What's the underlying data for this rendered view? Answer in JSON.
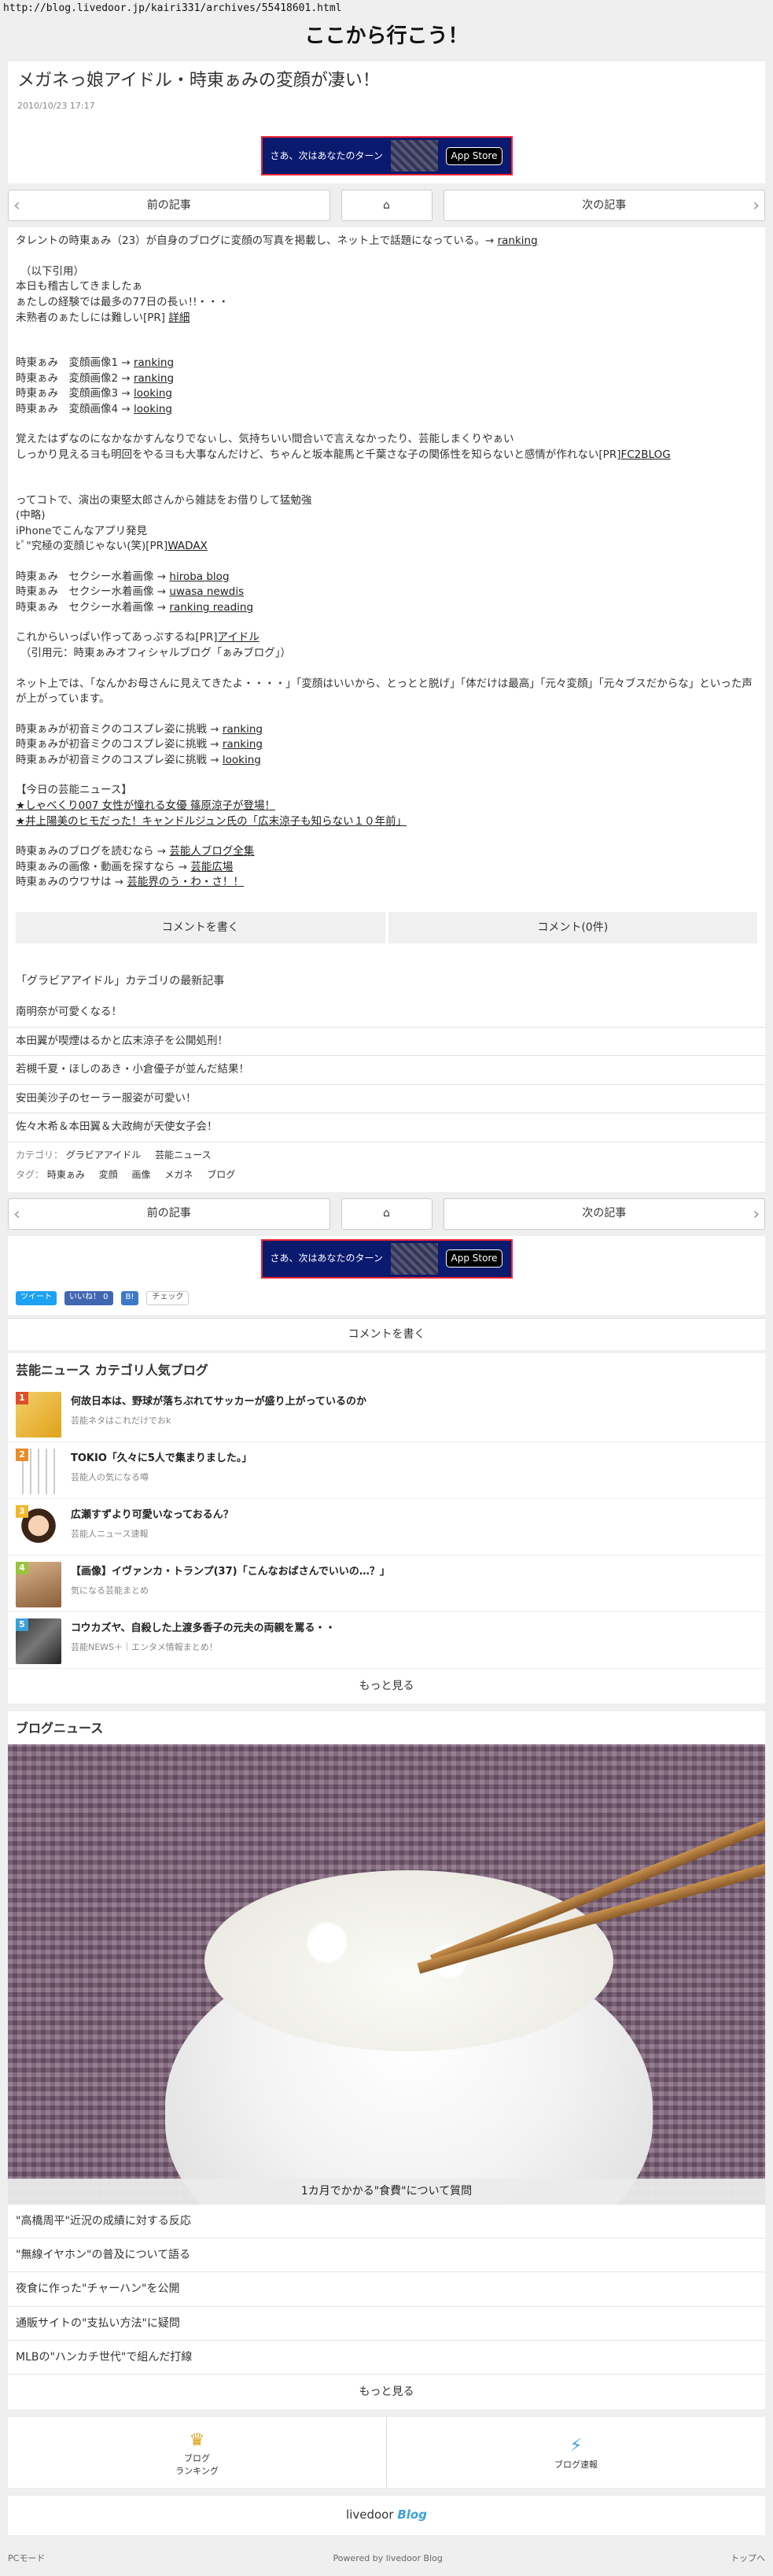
{
  "url": "http://blog.livedoor.jp/kairi331/archives/55418601.html",
  "site_title": "ここから行こう！",
  "article": {
    "title": "メガネっ娘アイドル・時東ぁみの変顔が凄い！",
    "date": "2010/10/23 17:17"
  },
  "ad": {
    "text": "さあ、次はあなたのターン",
    "store": "App Store"
  },
  "pager": {
    "prev": "前の記事",
    "next": "次の記事"
  },
  "body": {
    "lead": "タレントの時東ぁみ（23）が自身のブログに変顔の写真を掲載し、ネット上で話題になっている。→ ",
    "lead_link": "ranking",
    "quote_open": "（以下引用）",
    "q1": "本日も稽古してきましたぁ",
    "q2": "ぁたしの経験では最多の77日の長ぃ!!・・・",
    "q3a": "未熟者のぁたしには難しい[PR] ",
    "q3_link": "詳細",
    "img1": "時東ぁみ　変顔画像1 → ",
    "img1_link": "ranking",
    "img2": "時東ぁみ　変顔画像2 → ",
    "img2_link": "ranking",
    "img3": "時東ぁみ　変顔画像3 → ",
    "img3_link": "looking",
    "img4": "時東ぁみ　変顔画像4 → ",
    "img4_link": "looking",
    "p2a": "覚えたはずなのになかなかすんなりでなぃし、気持ちいい間合いで言えなかったり、芸能しまくりやぁい",
    "p2b": "しっかり見えるヨも明回をやるヨも大事なんだけど、ちゃんと坂本龍馬と千葉さな子の関係性を知らないと感情が作れない[PR]",
    "p2b_link": "FC2BLOG",
    "p3a": "ってコトで、演出の東堅太郎さんから雑誌をお借りして猛勉強",
    "p3b": "(中略)",
    "p3c": "iPhoneでこんなアプリ発見",
    "p3d_a": "ﾋﾟ\"究極の変顔じゃない(笑)[PR]",
    "p3d_link": "WADAX",
    "s1": "時東ぁみ　セクシー水着画像 → ",
    "s1_link": "hiroba blog",
    "s2": "時東ぁみ　セクシー水着画像 → ",
    "s2_link": "uwasa newdis",
    "s3": "時東ぁみ　セクシー水着画像 → ",
    "s3_link": "ranking reading",
    "p4a": "これからいっぱい作ってあっぷするね[PR]",
    "p4a_link": "アイドル",
    "p4b": "（引用元：時東ぁみオフィシャルブログ「ぁみブログ」）",
    "p5": "ネット上では、「なんかお母さんに見えてきたよ・・・・」「変顔はいいから、とっとと脱げ」「体だけは最高」「元々変顔」「元々ブスだからな」といった声が上がっています。",
    "m1": "時東ぁみが初音ミクのコスプレ姿に挑戦 → ",
    "m1_link": "ranking",
    "m2": "時東ぁみが初音ミクのコスプレ姿に挑戦 → ",
    "m2_link": "ranking",
    "m3": "時東ぁみが初音ミクのコスプレ姿に挑戦 → ",
    "m3_link": "looking",
    "today_title": "【今日の芸能ニュース】",
    "t1": "★しゃべくり007 女性が憧れる女優 篠原涼子が登場！",
    "t2": "★井上陽美のヒモだった！キャンドルジュン氏の「広末涼子も知らない１０年前」",
    "e1": "時東ぁみのブログを読むなら → ",
    "e1_link": "芸能人ブログ全集",
    "e2": "時東ぁみの画像・動画を探すなら → ",
    "e2_link": "芸能広場",
    "e3": "時東ぁみのウワサは → ",
    "e3_link": "芸能界のう・わ・さ！！"
  },
  "buttons": {
    "write": "コメントを書く",
    "count": "コメント(0件)"
  },
  "category": {
    "title": "「グラビアアイドル」カテゴリの最新記事",
    "items": [
      "南明奈が可愛くなる！",
      "本田翼が喫煙はるかと広末涼子を公開処刑！",
      "若槻千夏・ほしのあき・小倉優子が並んだ結果！",
      "安田美沙子のセーラー服姿が可愛い！",
      "佐々木希＆本田翼＆大政絢が天使女子会！"
    ]
  },
  "tags": {
    "cat_label": "カテゴリ：",
    "cat1": "グラビアアイドル",
    "cat2": "芸能ニュース",
    "tag_label": "タグ：",
    "tag_items": [
      "時東ぁみ",
      "変顔",
      "画像",
      "メガネ",
      "ブログ"
    ]
  },
  "social": {
    "tweet": "ツイート",
    "like": "いいね！ 0",
    "check": "チェック"
  },
  "comment_write": "コメントを書く",
  "popular": {
    "title": "芸能ニュース カテゴリ人気ブログ",
    "items": [
      {
        "rank": "1",
        "title": "何故日本は、野球が落ちぶれてサッカーが盛り上がっているのか",
        "sub": "芸能ネタはこれだけでおk"
      },
      {
        "rank": "2",
        "title": "TOKIO「久々に5人で集まりました。」",
        "sub": "芸能人の気になる噂"
      },
      {
        "rank": "3",
        "title": "広瀬すずより可愛いなっておるん？",
        "sub": "芸能人ニュース速報"
      },
      {
        "rank": "4",
        "title": "【画像】イヴァンカ・トランプ(37)「こんなおばさんでいいの…？」",
        "sub": "気になる芸能まとめ"
      },
      {
        "rank": "5",
        "title": "コウカズヤ、自殺した上渡多香子の元夫の両親を罵る・・",
        "sub": "芸能NEWS＋｜エンタメ情報まとめ！"
      }
    ],
    "more": "もっと見る"
  },
  "news": {
    "title": "ブログニュース",
    "caption": "1カ月でかかる\"食費\"について質問",
    "items": [
      "\"高橋周平\"近況の成績に対する反応",
      "\"無線イヤホン\"の普及について語る",
      "夜食に作った\"チャーハン\"を公開",
      "通販サイトの\"支払い方法\"に疑問",
      "MLBの\"ハンカチ世代\"で組んだ打線"
    ],
    "more": "もっと見る"
  },
  "footer": {
    "ranking": "ブログ\nランキング",
    "breaking": "ブログ速報",
    "logo_a": "livedoor",
    "logo_b": "Blog",
    "pc_mode": "PCモード",
    "powered": "Powered by livedoor Blog",
    "top": "トップへ"
  },
  "colors": {
    "tweet": "#1da1f2",
    "like": "#4267b2",
    "badge1": "#e04e2a",
    "badge2": "#e88d2a",
    "badge3": "#f1b82a",
    "badge4": "#9ac43b",
    "badge5": "#3aa0d8"
  }
}
